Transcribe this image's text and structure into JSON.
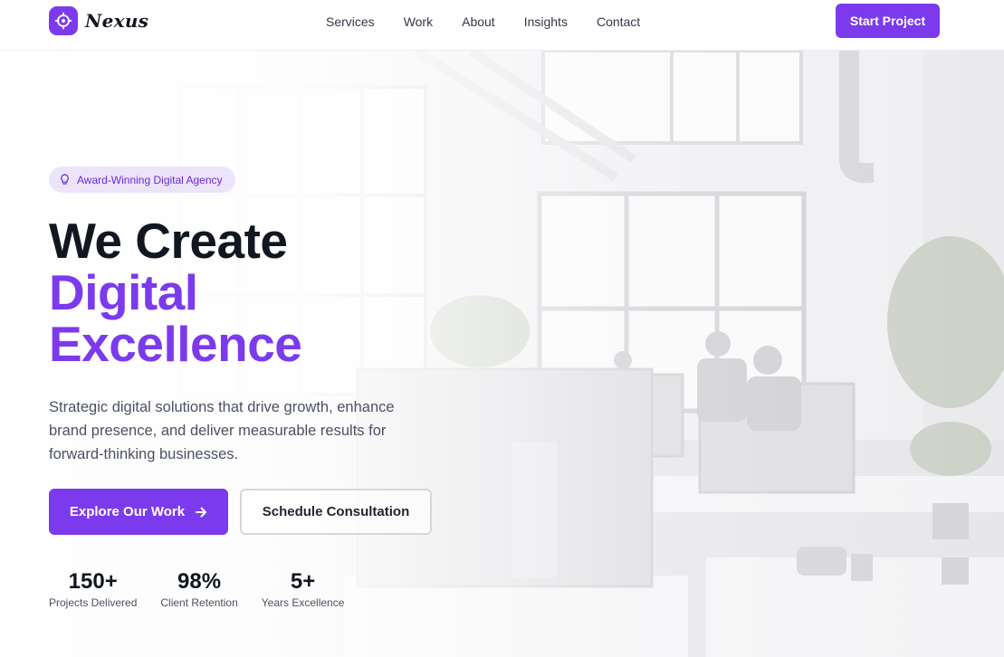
{
  "brand": {
    "name": "Nexus",
    "accent_color": "#7c3aed",
    "logo_icon": "crosshair-icon"
  },
  "nav": {
    "items": [
      {
        "label": "Services"
      },
      {
        "label": "Work"
      },
      {
        "label": "About"
      },
      {
        "label": "Insights"
      },
      {
        "label": "Contact"
      }
    ],
    "cta_label": "Start Project"
  },
  "hero": {
    "badge": {
      "icon": "lightbulb-icon",
      "text": "Award-Winning Digital Agency"
    },
    "headline": {
      "line1": "We Create",
      "line2": "Digital",
      "line3": "Excellence"
    },
    "subtext": "Strategic digital solutions that drive growth, enhance brand presence, and deliver measurable results for forward-thinking businesses.",
    "primary_button": {
      "label": "Explore Our Work",
      "icon": "arrow-right-icon"
    },
    "secondary_button": {
      "label": "Schedule Consultation"
    },
    "background_image": "office-workspace-photo"
  },
  "stats": [
    {
      "value": "150+",
      "label": "Projects Delivered"
    },
    {
      "value": "98%",
      "label": "Client Retention"
    },
    {
      "value": "5+",
      "label": "Years Excellence"
    }
  ]
}
